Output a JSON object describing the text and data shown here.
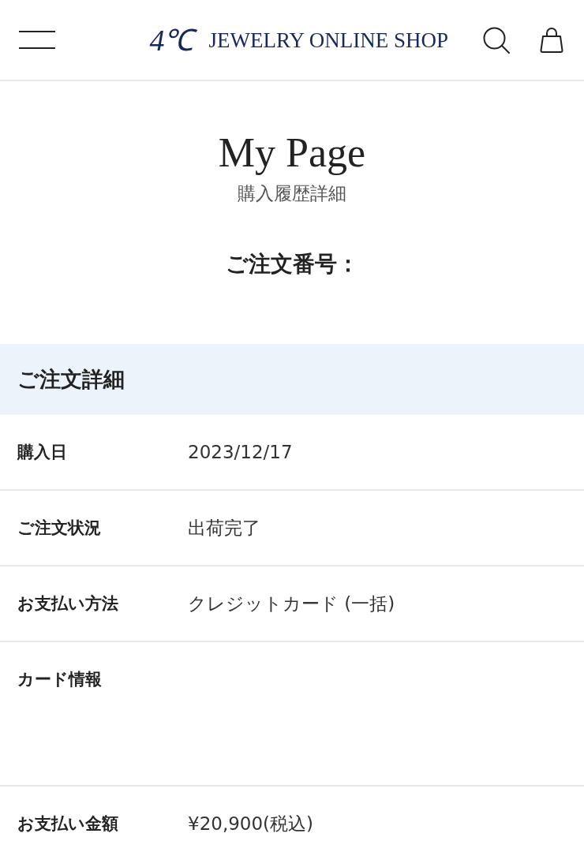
{
  "header": {
    "logo_mark": "4℃",
    "logo_text": "JEWELRY ONLINE SHOP"
  },
  "page": {
    "title": "My Page",
    "subtitle": "購入履歴詳細",
    "order_number_label": "ご注文番号："
  },
  "order_details": {
    "heading": "ご注文詳細",
    "rows": [
      {
        "label": "購入日",
        "value": "2023/12/17"
      },
      {
        "label": "ご注文状況",
        "value": "出荷完了"
      },
      {
        "label": "お支払い方法",
        "value": "クレジットカード (一括)"
      },
      {
        "label": "カード情報"
      },
      {
        "label": "お支払い金額",
        "value": "¥20,900(税込)"
      }
    ]
  }
}
